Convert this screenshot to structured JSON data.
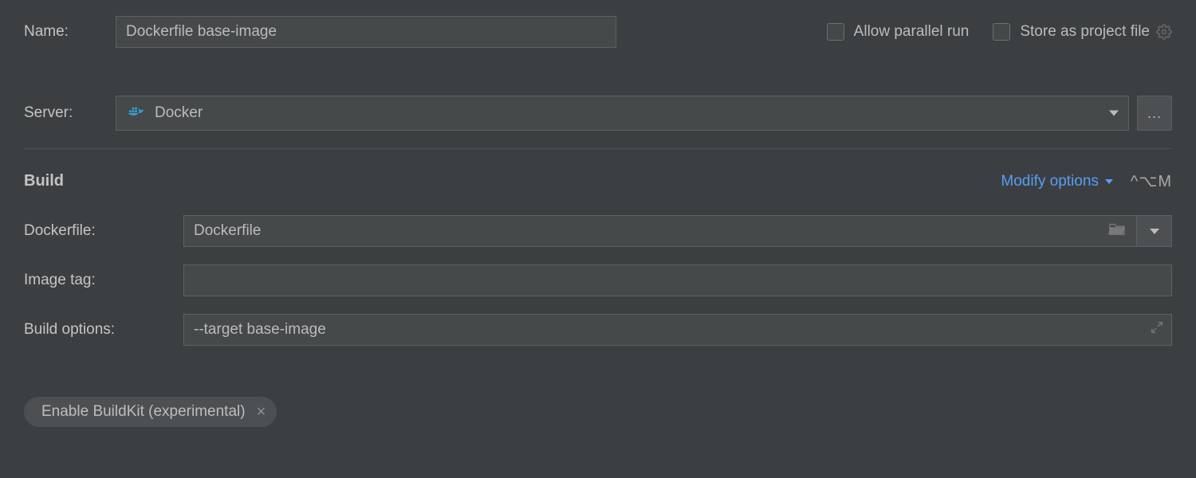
{
  "topRow": {
    "nameLabel": "Name:",
    "nameValue": "Dockerfile base-image",
    "allowParallelLabel": "Allow parallel run",
    "allowParallelChecked": false,
    "storeProjectLabel": "Store as project file",
    "storeProjectChecked": false
  },
  "server": {
    "label": "Server:",
    "value": "Docker",
    "browseGlyph": "..."
  },
  "build": {
    "sectionTitle": "Build",
    "modifyOptionsLabel": "Modify options",
    "shortcut": "^⌥M",
    "dockerfileLabel": "Dockerfile:",
    "dockerfileValue": "Dockerfile",
    "imageTagLabel": "Image tag:",
    "imageTagValue": "",
    "buildOptionsLabel": "Build options:",
    "buildOptionsValue": "--target base-image"
  },
  "tag": {
    "label": "Enable BuildKit (experimental)"
  }
}
